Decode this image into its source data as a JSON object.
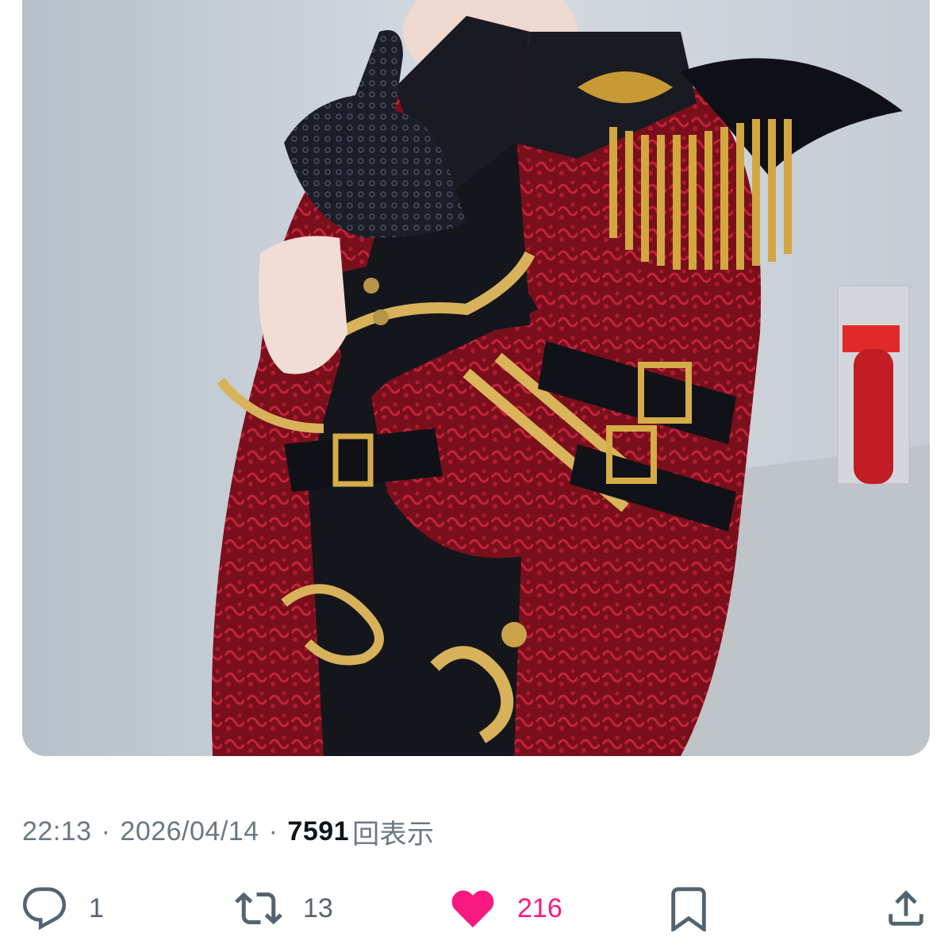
{
  "photo": {
    "alt": "Photo: person in a red and black brocade military-style jacket with gold embroidery, epaulette and black lace glove"
  },
  "tweet_meta": {
    "time": "22:13",
    "date": "2026/04/14",
    "separator": "·",
    "views_count": "7591",
    "views_label": "回表示"
  },
  "actions": {
    "reply_count": "1",
    "retweet_count": "13",
    "like_count": "216",
    "like_color": "#f91880",
    "icon_color": "#536471",
    "icons": [
      "reply-icon",
      "retweet-icon",
      "like-icon",
      "bookmark-icon",
      "share-icon"
    ]
  }
}
